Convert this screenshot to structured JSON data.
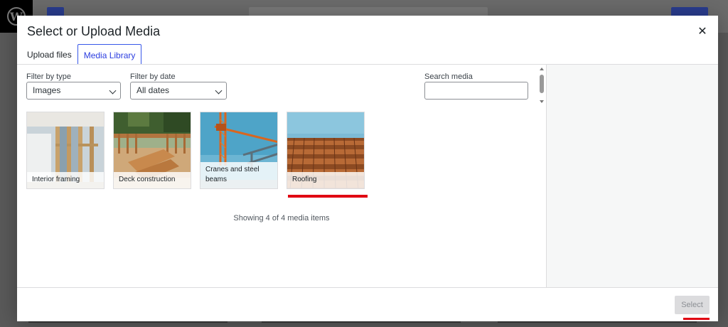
{
  "modal": {
    "title": "Select or Upload Media",
    "close_icon": "close-icon"
  },
  "tabs": [
    {
      "label": "Upload files",
      "active": false
    },
    {
      "label": "Media Library",
      "active": true
    }
  ],
  "filters": {
    "type_label": "Filter by type",
    "type_value": "Images",
    "date_label": "Filter by date",
    "date_value": "All dates",
    "search_label": "Search media",
    "search_value": ""
  },
  "media_items": [
    {
      "caption": "Interior framing",
      "selected": false
    },
    {
      "caption": "Deck construction",
      "selected": false
    },
    {
      "caption": "Cranes and steel beams",
      "selected": false
    },
    {
      "caption": "Roofing",
      "selected": false
    }
  ],
  "status": {
    "count_text": "Showing 4 of 4 media items"
  },
  "footer": {
    "select_label": "Select",
    "select_enabled": false
  },
  "colors": {
    "accent": "#3858e9",
    "annotation_red": "#e00012",
    "dim_background": "#5a5a5a"
  }
}
